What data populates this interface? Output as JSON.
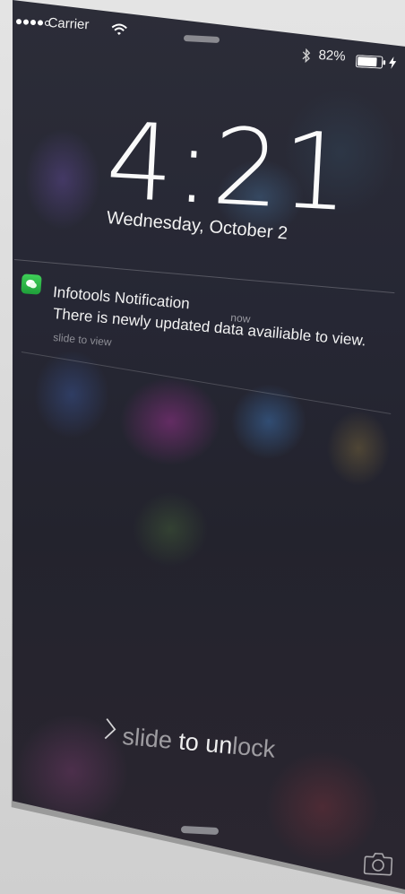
{
  "status_bar": {
    "signal_bars_filled": 4,
    "signal_bars_total": 5,
    "carrier": "Carrier",
    "wifi_icon": "wifi-icon",
    "bluetooth_icon": "bluetooth-icon",
    "battery_percent": "82%",
    "battery_level": 0.82,
    "charging_icon": "charging-bolt-icon"
  },
  "lock_screen": {
    "time": "4:21",
    "date": "Wednesday, October 2"
  },
  "notification": {
    "app_icon": "messages-app-icon",
    "app_icon_color": "#2fbf4a",
    "title": "Infotools Notification",
    "time": "now",
    "body": "There is newly updated data availiable to view.",
    "action_hint": "slide to view"
  },
  "unlock": {
    "chevron_icon": "chevron-right-icon",
    "label_part1": "slide ",
    "label_part2": "to un",
    "label_part3": "lock"
  },
  "camera_icon": "camera-icon"
}
